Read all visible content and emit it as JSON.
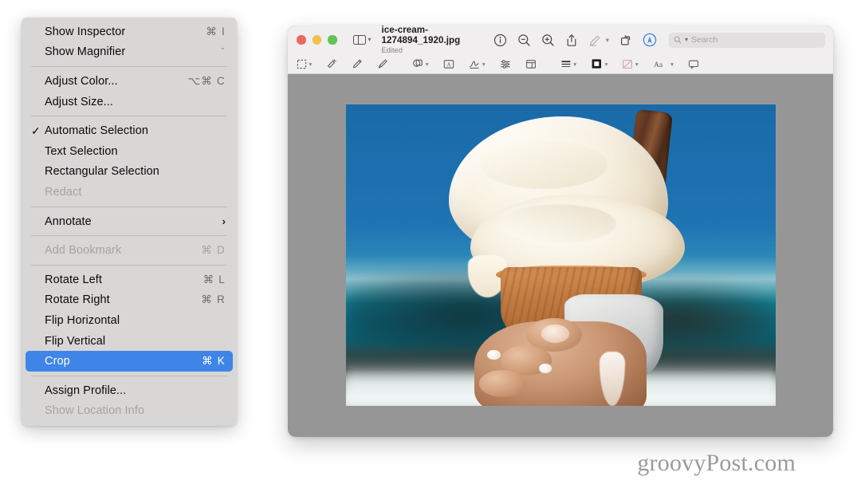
{
  "context_menu": {
    "groups": [
      {
        "items": [
          {
            "label": "Show Inspector",
            "shortcut": "⌘ I",
            "state": "normal",
            "checked": false,
            "submenu": false
          },
          {
            "label": "Show Magnifier",
            "shortcut": "`",
            "state": "normal",
            "checked": false,
            "submenu": false
          }
        ]
      },
      {
        "items": [
          {
            "label": "Adjust Color...",
            "shortcut": "⌥⌘ C",
            "state": "normal",
            "checked": false,
            "submenu": false
          },
          {
            "label": "Adjust Size...",
            "shortcut": "",
            "state": "normal",
            "checked": false,
            "submenu": false
          }
        ]
      },
      {
        "items": [
          {
            "label": "Automatic Selection",
            "shortcut": "",
            "state": "normal",
            "checked": true,
            "submenu": false
          },
          {
            "label": "Text Selection",
            "shortcut": "",
            "state": "normal",
            "checked": false,
            "submenu": false
          },
          {
            "label": "Rectangular Selection",
            "shortcut": "",
            "state": "normal",
            "checked": false,
            "submenu": false
          },
          {
            "label": "Redact",
            "shortcut": "",
            "state": "disabled",
            "checked": false,
            "submenu": false
          }
        ]
      },
      {
        "items": [
          {
            "label": "Annotate",
            "shortcut": "",
            "state": "normal",
            "checked": false,
            "submenu": true
          }
        ]
      },
      {
        "items": [
          {
            "label": "Add Bookmark",
            "shortcut": "⌘ D",
            "state": "disabled",
            "checked": false,
            "submenu": false
          }
        ]
      },
      {
        "items": [
          {
            "label": "Rotate Left",
            "shortcut": "⌘ L",
            "state": "normal",
            "checked": false,
            "submenu": false
          },
          {
            "label": "Rotate Right",
            "shortcut": "⌘ R",
            "state": "normal",
            "checked": false,
            "submenu": false
          },
          {
            "label": "Flip Horizontal",
            "shortcut": "",
            "state": "normal",
            "checked": false,
            "submenu": false
          },
          {
            "label": "Flip Vertical",
            "shortcut": "",
            "state": "normal",
            "checked": false,
            "submenu": false
          },
          {
            "label": "Crop",
            "shortcut": "⌘ K",
            "state": "selected",
            "checked": false,
            "submenu": false
          }
        ]
      },
      {
        "items": [
          {
            "label": "Assign Profile...",
            "shortcut": "",
            "state": "normal",
            "checked": false,
            "submenu": false
          },
          {
            "label": "Show Location Info",
            "shortcut": "",
            "state": "disabled",
            "checked": false,
            "submenu": false
          }
        ]
      }
    ],
    "checkmark_glyph": "✓",
    "submenu_glyph": "›",
    "highlight_color": "#3f85e8",
    "background_color": "#d9d6d6"
  },
  "window": {
    "traffic_lights": [
      {
        "name": "close",
        "color": "#ec6a5e"
      },
      {
        "name": "minimize",
        "color": "#f3bf4f"
      },
      {
        "name": "zoom",
        "color": "#61c454"
      }
    ],
    "sidebar_button_label": "",
    "document_title": "ice-cream-1274894_1920.jpg",
    "document_status": "Edited",
    "toolbar_icons": [
      "info-icon",
      "zoom-out-icon",
      "zoom-in-icon",
      "share-icon",
      "markup-pen-icon",
      "rotate-icon",
      "highlight-icon"
    ],
    "search": {
      "placeholder": "Search",
      "value": ""
    },
    "markup_tools": [
      "selection-tool-icon",
      "instant-alpha-icon",
      "sketch-icon",
      "draw-icon",
      "shapes-icon",
      "text-tool-icon",
      "sign-icon",
      "adjust-icon",
      "crop-icon",
      "shape-style-icon",
      "border-color-icon",
      "fill-color-icon",
      "text-style-icon",
      "note-icon"
    ],
    "canvas_background": "#969696"
  },
  "watermark": {
    "text": "groovyPost.com"
  }
}
